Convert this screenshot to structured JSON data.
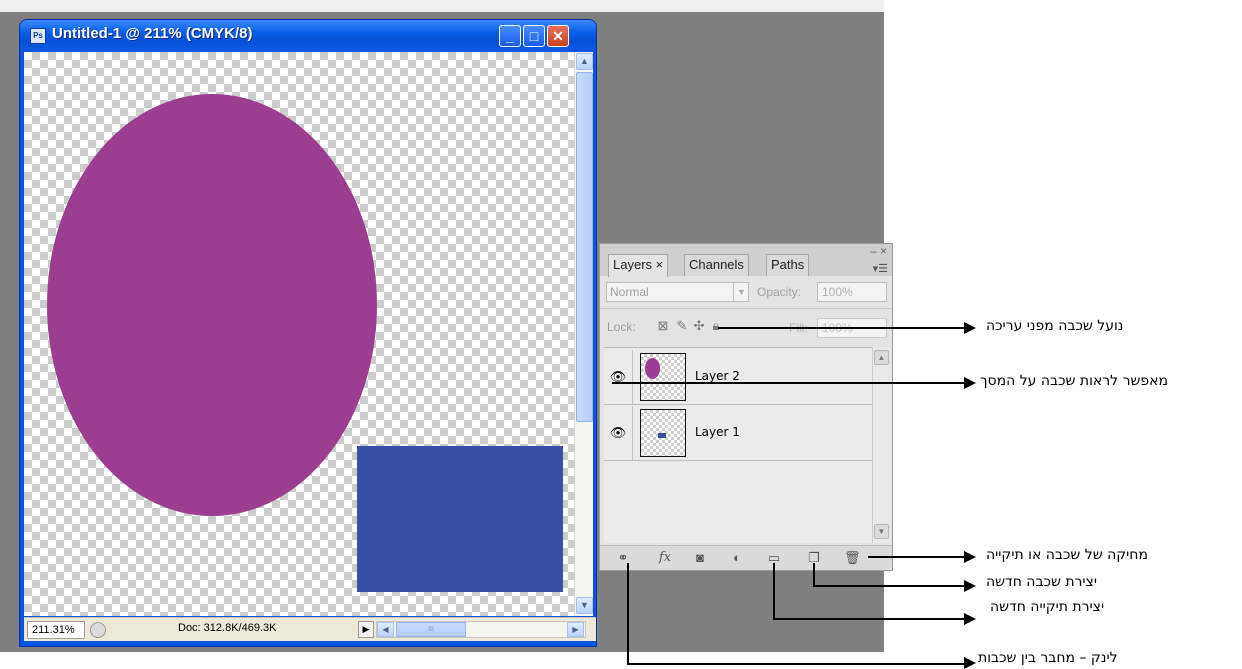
{
  "document": {
    "title": "Untitled-1 @ 211% (CMYK/8)",
    "app_icon": "Ps",
    "zoom": "211.31%",
    "doc_info": "Doc: 312.8K/469.3K",
    "colors": {
      "ellipse": "#9c3e8f",
      "rectangle": "#3a50a5"
    }
  },
  "layers_panel": {
    "tabs": [
      {
        "label": "Layers ×"
      },
      {
        "label": "Channels"
      },
      {
        "label": "Paths"
      }
    ],
    "blend_mode": "Normal",
    "opacity_label": "Opacity:",
    "opacity_value": "100%",
    "lock_label": "Lock:",
    "fill_label": "Fill:",
    "fill_value": "100%",
    "layers": [
      {
        "name": "Layer 2",
        "visible": true
      },
      {
        "name": "Layer 1",
        "visible": true
      }
    ]
  },
  "annotations": {
    "lock": "נועל שכבה מפני עריכה",
    "visibility": "מאפשר לראות שכבה על המסך",
    "delete": "מחיקה של שכבה או תיקייה",
    "new_layer": "יצירת שכבה חדשה",
    "new_folder": "יצירת תיקייה חדשה",
    "link": "לינק – מחבר בין שכבות"
  }
}
